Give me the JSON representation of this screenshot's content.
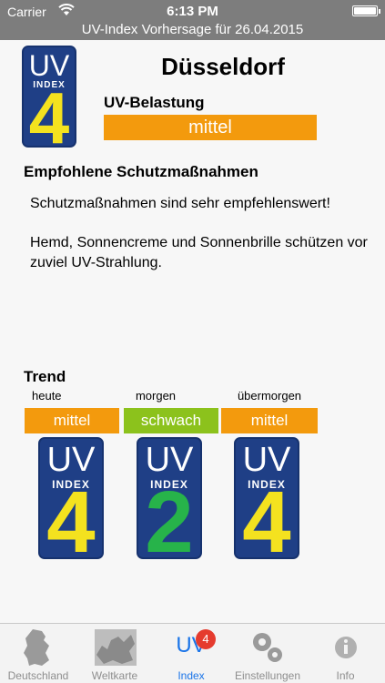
{
  "status_bar": {
    "carrier": "Carrier",
    "time": "6:13 PM"
  },
  "title": "UV-Index Vorhersage für 26.04.2015",
  "colors": {
    "badge_blue": "#1f3f86",
    "level_mittel": "#f39a0d",
    "level_schwach": "#8cc21c",
    "number_yellow": "#f4e21f",
    "number_green": "#27b34a",
    "accent_blue": "#1a74e8"
  },
  "main": {
    "badge": {
      "letters": "UV",
      "word": "INDEX",
      "number": "4"
    },
    "city": "Düsseldorf",
    "belastung_label": "UV-Belastung",
    "level": "mittel"
  },
  "recommendations": {
    "title": "Empfohlene Schutzmaßnahmen",
    "line1": "Schutzmaßnahmen sind sehr empfehlenswert!",
    "line2": "Hemd, Sonnencreme und Sonnenbrille schützen vor zuviel UV-Strahlung."
  },
  "trend": {
    "title": "Trend",
    "days": [
      {
        "label": "heute",
        "level": "mittel",
        "letters": "UV",
        "word": "INDEX",
        "number": "4"
      },
      {
        "label": "morgen",
        "level": "schwach",
        "letters": "UV",
        "word": "INDEX",
        "number": "2"
      },
      {
        "label": "übermorgen",
        "level": "mittel",
        "letters": "UV",
        "word": "INDEX",
        "number": "4"
      }
    ]
  },
  "tabs": [
    {
      "label": "Deutschland",
      "icon": "germany-map-icon"
    },
    {
      "label": "Weltkarte",
      "icon": "europe-map-icon"
    },
    {
      "label": "Index",
      "icon": "uv-text-icon",
      "icon_text": "UV",
      "badge": "4"
    },
    {
      "label": "Einstellungen",
      "icon": "gears-icon"
    },
    {
      "label": "Info",
      "icon": "info-icon"
    }
  ]
}
